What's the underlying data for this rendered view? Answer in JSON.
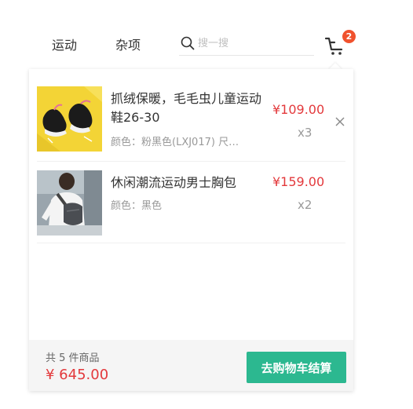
{
  "nav": {
    "links": [
      "运动",
      "杂项"
    ],
    "search_placeholder": "搜一搜",
    "search_icon": "search-icon",
    "cart_icon": "cart-icon",
    "cart_count": "2"
  },
  "cart": {
    "items": [
      {
        "title": "抓绒保暖，毛毛虫儿童运动鞋26-30",
        "spec": "颜色：粉黑色(LXJ017) 尺…",
        "price": "¥109.00",
        "qty": "x3"
      },
      {
        "title": "休闲潮流运动男士胸包",
        "spec": "颜色：黑色",
        "price": "¥159.00",
        "qty": "x2"
      }
    ],
    "total_count": "共 5 件商品",
    "total_price": "¥ 645.00",
    "checkout_label": "去购物车结算"
  },
  "colors": {
    "price": "#e3393c",
    "accent": "#2cb890",
    "badge": "#f0522e"
  }
}
